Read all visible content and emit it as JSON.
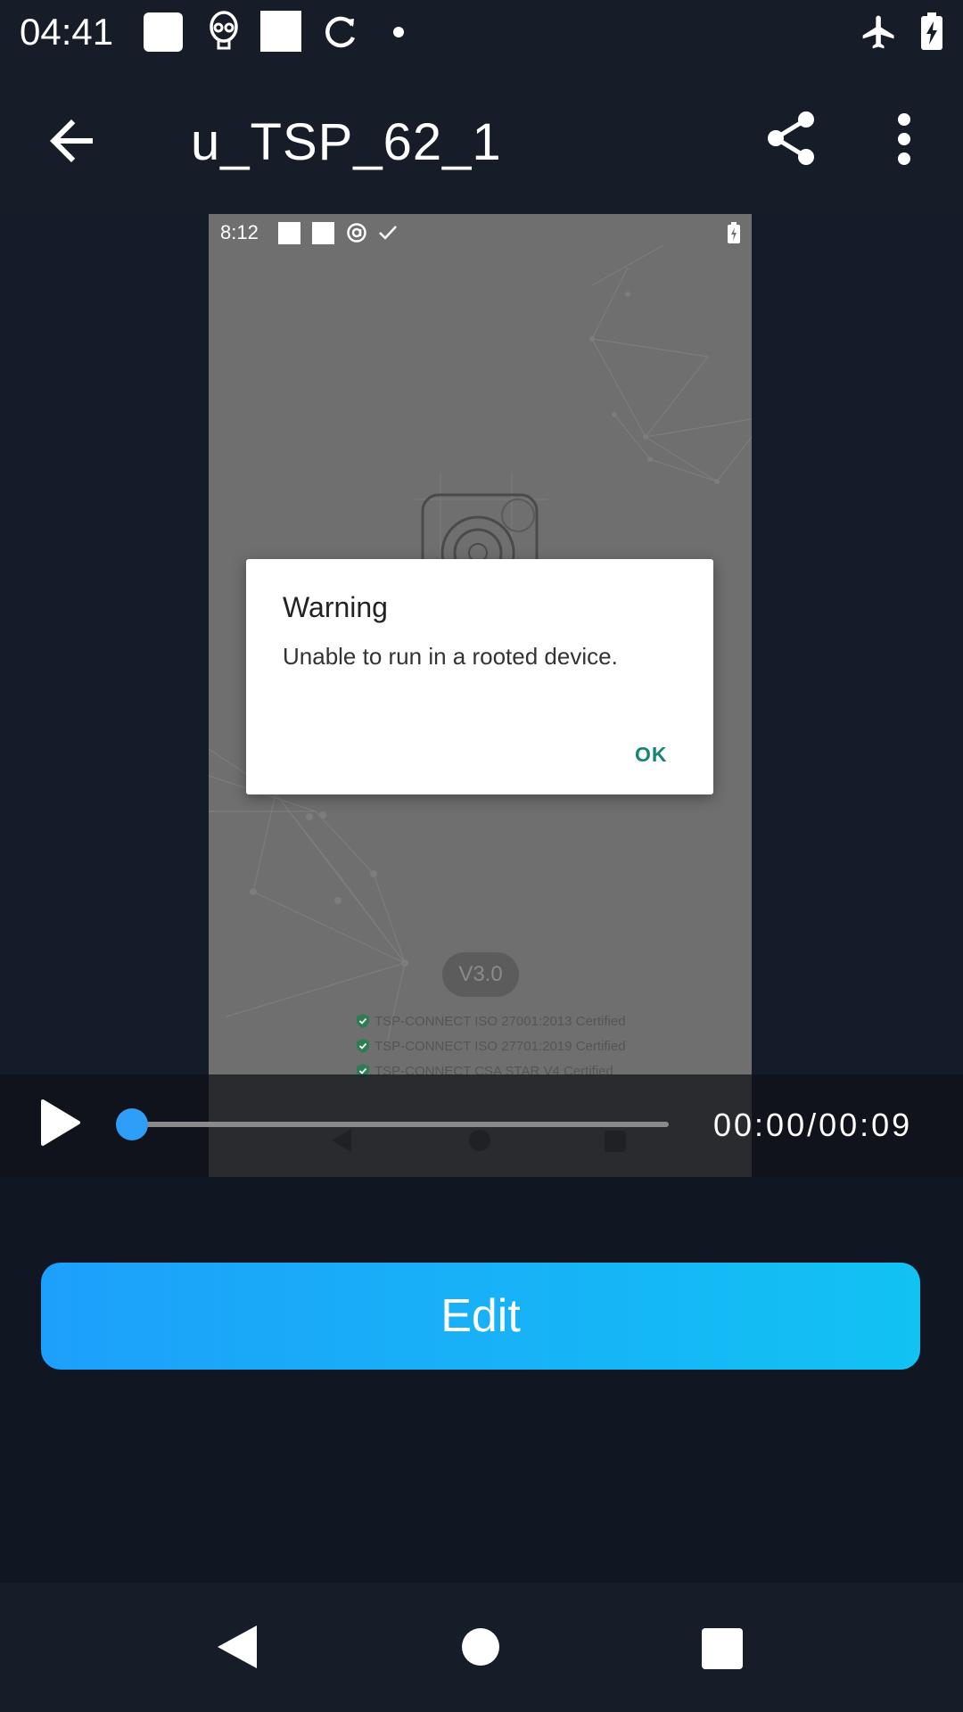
{
  "status_bar": {
    "time": "04:41",
    "icons": [
      "square-notification-icon",
      "alien-icon",
      "square-notification-icon",
      "sync-icon",
      "dot-icon",
      "airplane-mode-icon",
      "battery-charging-icon"
    ]
  },
  "app_bar": {
    "title": "u_TSP_62_1",
    "back_icon": "arrow-back-icon",
    "share_icon": "share-icon",
    "more_icon": "more-vert-icon"
  },
  "video": {
    "inner_status": {
      "time": "8:12"
    },
    "dialog": {
      "title": "Warning",
      "message": "Unable to run in a rooted device.",
      "ok_label": "OK"
    },
    "version_label": "V3.0",
    "certifications": [
      "TSP-CONNECT ISO 27001:2013 Certified",
      "TSP-CONNECT ISO 27701:2019 Certified",
      "TSP-CONNECT CSA STAR V4 Certified"
    ]
  },
  "player": {
    "play_icon": "play-icon",
    "time_display": "00:00/00:09",
    "progress": 0.0
  },
  "actions": {
    "edit_label": "Edit"
  },
  "colors": {
    "background": "#111722",
    "bar_background": "#161c28",
    "accent": "#2e9ef8",
    "edit_gradient_start": "#1da0fb",
    "edit_gradient_end": "#12c2f3",
    "dialog_ok": "#148573"
  }
}
